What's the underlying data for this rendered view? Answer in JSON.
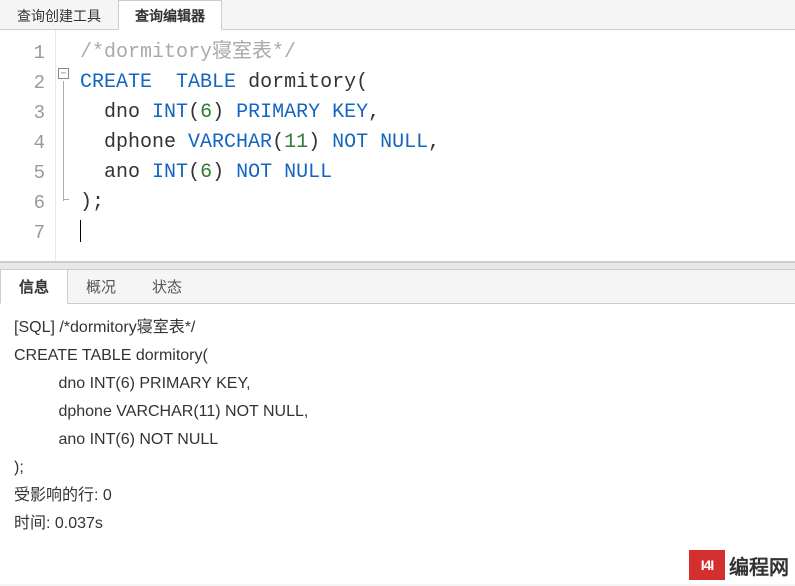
{
  "tabs_top": [
    {
      "label": "查询创建工具",
      "active": false
    },
    {
      "label": "查询编辑器",
      "active": true
    }
  ],
  "editor": {
    "line_count": 7,
    "code_html": "<span class=\"c-comment\">/*dormitory寝室表*/</span>\n<span class=\"c-keyword\">CREATE</span>  <span class=\"c-keyword\">TABLE</span> <span class=\"c-ident\">dormitory</span><span class=\"c-punct\">(</span>\n  <span class=\"c-ident\">dno</span> <span class=\"c-type\">INT</span><span class=\"c-punct\">(</span><span class=\"c-num\">6</span><span class=\"c-punct\">)</span> <span class=\"c-keyword\">PRIMARY</span> <span class=\"c-keyword\">KEY</span><span class=\"c-punct\">,</span>\n  <span class=\"c-ident\">dphone</span> <span class=\"c-type\">VARCHAR</span><span class=\"c-punct\">(</span><span class=\"c-num\">11</span><span class=\"c-punct\">)</span> <span class=\"c-keyword\">NOT</span> <span class=\"c-keyword\">NULL</span><span class=\"c-punct\">,</span>\n  <span class=\"c-ident\">ano</span> <span class=\"c-type\">INT</span><span class=\"c-punct\">(</span><span class=\"c-num\">6</span><span class=\"c-punct\">)</span> <span class=\"c-keyword\">NOT</span> <span class=\"c-keyword\">NULL</span>\n<span class=\"c-punct\">);</span>\n<span class=\"cursor\"></span>"
  },
  "tabs_bottom": [
    {
      "label": "信息",
      "active": true
    },
    {
      "label": "概况",
      "active": false
    },
    {
      "label": "状态",
      "active": false
    }
  ],
  "output_text": "[SQL] /*dormitory寝室表*/\nCREATE TABLE dormitory(\n          dno INT(6) PRIMARY KEY,\n          dphone VARCHAR(11) NOT NULL,\n          ano INT(6) NOT NULL\n);\n受影响的行: 0\n时间: 0.037s",
  "watermark": {
    "logo_text": "I4I",
    "label": "编程网"
  }
}
